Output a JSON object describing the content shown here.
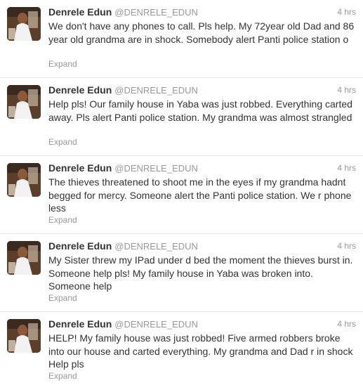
{
  "tweets": [
    {
      "fullname": "Denrele Edun",
      "username": "@DENRELE_EDUN",
      "time": "4 hrs",
      "text": "We don't have any phones to call. Pls help. My 72year old Dad and 86 year old grandma are in shock. Somebody alert Panti police station o",
      "expand": "Expand"
    },
    {
      "fullname": "Denrele Edun",
      "username": "@DENRELE_EDUN",
      "time": "4 hrs",
      "text": "Help pls! Our family house in Yaba was just robbed. Everything carted away. Pls alert Panti police station. My grandma was almost strangled",
      "expand": "Expand"
    },
    {
      "fullname": "Denrele Edun",
      "username": "@DENRELE_EDUN",
      "time": "4 hrs",
      "text": "The thieves threatened to shoot me in the eyes if my grandma hadnt begged for mercy. Someone alert the Panti police station. We r phone less",
      "expand": "Expand"
    },
    {
      "fullname": "Denrele Edun",
      "username": "@DENRELE_EDUN",
      "time": "4 hrs",
      "text": "My Sister threw my IPad under d bed the moment the thieves burst in. Someone help pls! My family house in Yaba was broken into. Someone help",
      "expand": "Expand"
    },
    {
      "fullname": "Denrele Edun",
      "username": "@DENRELE_EDUN",
      "time": "4 hrs",
      "text": "HELP! My family house was just robbed! Five armed robbers broke into our house and carted everything. My grandma and Dad r in shock Help pls",
      "expand": "Expand"
    }
  ]
}
